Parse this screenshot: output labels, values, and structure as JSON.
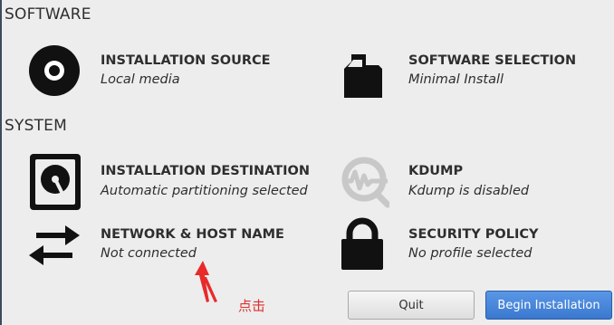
{
  "sections": {
    "software_title": "SOFTWARE",
    "system_title": "SYSTEM"
  },
  "spokes": {
    "installation_source": {
      "title": "INSTALLATION SOURCE",
      "status": "Local media",
      "icon": "disc-icon"
    },
    "software_selection": {
      "title": "SOFTWARE SELECTION",
      "status": "Minimal Install",
      "icon": "package-icon"
    },
    "installation_destination": {
      "title": "INSTALLATION DESTINATION",
      "status": "Automatic partitioning selected",
      "icon": "hard-disk-icon"
    },
    "kdump": {
      "title": "KDUMP",
      "status": "Kdump is disabled",
      "icon": "kdump-magnifier-icon"
    },
    "network_host": {
      "title": "NETWORK & HOST NAME",
      "status": "Not connected",
      "icon": "network-arrows-icon"
    },
    "security_policy": {
      "title": "SECURITY POLICY",
      "status": "No profile selected",
      "icon": "lock-icon"
    }
  },
  "buttons": {
    "quit": "Quit",
    "begin_installation": "Begin Installation"
  },
  "annotation": {
    "text": "点击",
    "color": "#e03030"
  },
  "colors": {
    "background": "#ededed",
    "primary_button": "#3a78cf",
    "text": "#2e2e2e"
  }
}
